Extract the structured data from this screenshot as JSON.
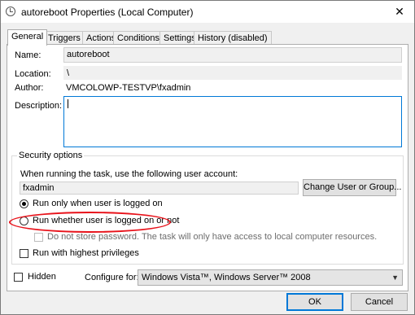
{
  "window": {
    "title": "autoreboot Properties (Local Computer)",
    "close_glyph": "✕"
  },
  "tabs": [
    {
      "label": "General",
      "active": true
    },
    {
      "label": "Triggers"
    },
    {
      "label": "Actions"
    },
    {
      "label": "Conditions"
    },
    {
      "label": "Settings"
    },
    {
      "label": "History (disabled)"
    }
  ],
  "general": {
    "name_label": "Name:",
    "name_value": "autoreboot",
    "location_label": "Location:",
    "location_value": "\\",
    "author_label": "Author:",
    "author_value": "VMCOLOWP-TESTVP\\fxadmin",
    "description_label": "Description:",
    "description_value": ""
  },
  "security": {
    "group_title": "Security options",
    "account_prompt": "When running the task, use the following user account:",
    "account_value": "fxadmin",
    "change_button": "Change User or Group...",
    "radio_logged_on": "Run only when user is logged on",
    "radio_logged_on_checked": true,
    "radio_whether": "Run whether user is logged on or not",
    "radio_whether_checked": false,
    "no_store_password": "Do not store password.  The task will only have access to local computer resources.",
    "highest_privileges": "Run with highest privileges"
  },
  "footer": {
    "hidden_label": "Hidden",
    "configure_label": "Configure for:",
    "configure_value": "Windows Vista™, Windows Server™ 2008",
    "ok_button": "OK",
    "cancel_button": "Cancel"
  },
  "colors": {
    "accent": "#0078d7",
    "annotation": "#e8121a"
  },
  "icons": [
    "task-scheduler-clock-icon",
    "close-icon",
    "chevron-down-icon"
  ]
}
